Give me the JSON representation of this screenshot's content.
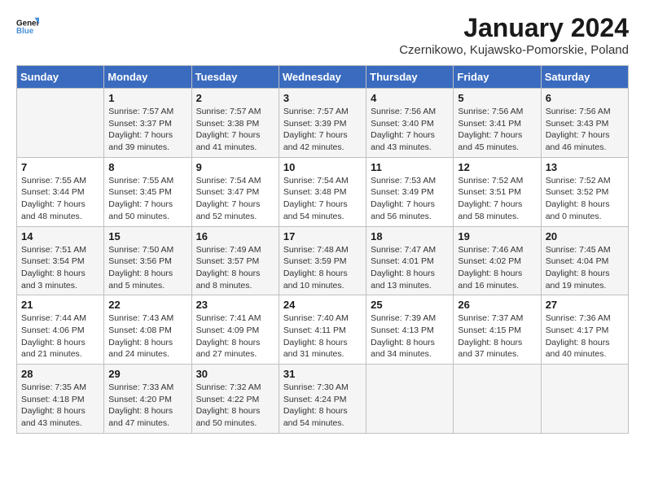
{
  "header": {
    "logo_line1": "General",
    "logo_line2": "Blue",
    "month_title": "January 2024",
    "location": "Czernikowo, Kujawsko-Pomorskie, Poland"
  },
  "weekdays": [
    "Sunday",
    "Monday",
    "Tuesday",
    "Wednesday",
    "Thursday",
    "Friday",
    "Saturday"
  ],
  "weeks": [
    [
      {
        "day": "",
        "info": ""
      },
      {
        "day": "1",
        "info": "Sunrise: 7:57 AM\nSunset: 3:37 PM\nDaylight: 7 hours\nand 39 minutes."
      },
      {
        "day": "2",
        "info": "Sunrise: 7:57 AM\nSunset: 3:38 PM\nDaylight: 7 hours\nand 41 minutes."
      },
      {
        "day": "3",
        "info": "Sunrise: 7:57 AM\nSunset: 3:39 PM\nDaylight: 7 hours\nand 42 minutes."
      },
      {
        "day": "4",
        "info": "Sunrise: 7:56 AM\nSunset: 3:40 PM\nDaylight: 7 hours\nand 43 minutes."
      },
      {
        "day": "5",
        "info": "Sunrise: 7:56 AM\nSunset: 3:41 PM\nDaylight: 7 hours\nand 45 minutes."
      },
      {
        "day": "6",
        "info": "Sunrise: 7:56 AM\nSunset: 3:43 PM\nDaylight: 7 hours\nand 46 minutes."
      }
    ],
    [
      {
        "day": "7",
        "info": "Sunrise: 7:55 AM\nSunset: 3:44 PM\nDaylight: 7 hours\nand 48 minutes."
      },
      {
        "day": "8",
        "info": "Sunrise: 7:55 AM\nSunset: 3:45 PM\nDaylight: 7 hours\nand 50 minutes."
      },
      {
        "day": "9",
        "info": "Sunrise: 7:54 AM\nSunset: 3:47 PM\nDaylight: 7 hours\nand 52 minutes."
      },
      {
        "day": "10",
        "info": "Sunrise: 7:54 AM\nSunset: 3:48 PM\nDaylight: 7 hours\nand 54 minutes."
      },
      {
        "day": "11",
        "info": "Sunrise: 7:53 AM\nSunset: 3:49 PM\nDaylight: 7 hours\nand 56 minutes."
      },
      {
        "day": "12",
        "info": "Sunrise: 7:52 AM\nSunset: 3:51 PM\nDaylight: 7 hours\nand 58 minutes."
      },
      {
        "day": "13",
        "info": "Sunrise: 7:52 AM\nSunset: 3:52 PM\nDaylight: 8 hours\nand 0 minutes."
      }
    ],
    [
      {
        "day": "14",
        "info": "Sunrise: 7:51 AM\nSunset: 3:54 PM\nDaylight: 8 hours\nand 3 minutes."
      },
      {
        "day": "15",
        "info": "Sunrise: 7:50 AM\nSunset: 3:56 PM\nDaylight: 8 hours\nand 5 minutes."
      },
      {
        "day": "16",
        "info": "Sunrise: 7:49 AM\nSunset: 3:57 PM\nDaylight: 8 hours\nand 8 minutes."
      },
      {
        "day": "17",
        "info": "Sunrise: 7:48 AM\nSunset: 3:59 PM\nDaylight: 8 hours\nand 10 minutes."
      },
      {
        "day": "18",
        "info": "Sunrise: 7:47 AM\nSunset: 4:01 PM\nDaylight: 8 hours\nand 13 minutes."
      },
      {
        "day": "19",
        "info": "Sunrise: 7:46 AM\nSunset: 4:02 PM\nDaylight: 8 hours\nand 16 minutes."
      },
      {
        "day": "20",
        "info": "Sunrise: 7:45 AM\nSunset: 4:04 PM\nDaylight: 8 hours\nand 19 minutes."
      }
    ],
    [
      {
        "day": "21",
        "info": "Sunrise: 7:44 AM\nSunset: 4:06 PM\nDaylight: 8 hours\nand 21 minutes."
      },
      {
        "day": "22",
        "info": "Sunrise: 7:43 AM\nSunset: 4:08 PM\nDaylight: 8 hours\nand 24 minutes."
      },
      {
        "day": "23",
        "info": "Sunrise: 7:41 AM\nSunset: 4:09 PM\nDaylight: 8 hours\nand 27 minutes."
      },
      {
        "day": "24",
        "info": "Sunrise: 7:40 AM\nSunset: 4:11 PM\nDaylight: 8 hours\nand 31 minutes."
      },
      {
        "day": "25",
        "info": "Sunrise: 7:39 AM\nSunset: 4:13 PM\nDaylight: 8 hours\nand 34 minutes."
      },
      {
        "day": "26",
        "info": "Sunrise: 7:37 AM\nSunset: 4:15 PM\nDaylight: 8 hours\nand 37 minutes."
      },
      {
        "day": "27",
        "info": "Sunrise: 7:36 AM\nSunset: 4:17 PM\nDaylight: 8 hours\nand 40 minutes."
      }
    ],
    [
      {
        "day": "28",
        "info": "Sunrise: 7:35 AM\nSunset: 4:18 PM\nDaylight: 8 hours\nand 43 minutes."
      },
      {
        "day": "29",
        "info": "Sunrise: 7:33 AM\nSunset: 4:20 PM\nDaylight: 8 hours\nand 47 minutes."
      },
      {
        "day": "30",
        "info": "Sunrise: 7:32 AM\nSunset: 4:22 PM\nDaylight: 8 hours\nand 50 minutes."
      },
      {
        "day": "31",
        "info": "Sunrise: 7:30 AM\nSunset: 4:24 PM\nDaylight: 8 hours\nand 54 minutes."
      },
      {
        "day": "",
        "info": ""
      },
      {
        "day": "",
        "info": ""
      },
      {
        "day": "",
        "info": ""
      }
    ]
  ]
}
